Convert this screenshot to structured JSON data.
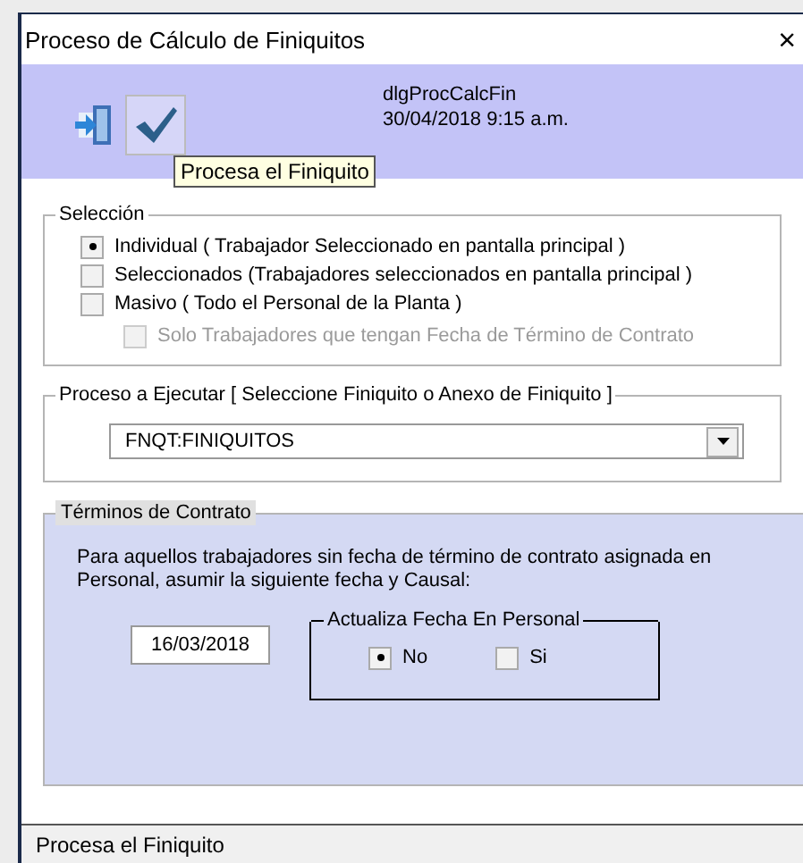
{
  "window": {
    "title": "Proceso de Cálculo de Finiquitos",
    "close": "×"
  },
  "toolbar": {
    "form_name": "dlgProcCalcFin",
    "datetime": "30/04/2018 9:15 a.m.",
    "tooltip": "Procesa el Finiquito"
  },
  "seleccion": {
    "title": "Selección",
    "options": [
      {
        "label": "Individual ( Trabajador Seleccionado en pantalla principal )",
        "selected": true
      },
      {
        "label": "Seleccionados (Trabajadores seleccionados en pantalla principal )",
        "selected": false
      },
      {
        "label": "Masivo ( Todo el Personal de la Planta )",
        "selected": false
      }
    ],
    "filter": {
      "label": "Solo Trabajadores que tengan Fecha de Término de Contrato",
      "checked": false,
      "disabled": true
    }
  },
  "proceso": {
    "title": "Proceso a Ejecutar [ Seleccione Finiquito o Anexo de Finiquito ]",
    "value": "FNQT:FINIQUITOS"
  },
  "terminos": {
    "title": "Términos de Contrato",
    "description": "Para aquellos trabajadores sin fecha de término de contrato asignada en Personal, asumir la siguiente fecha y Causal:",
    "date": "16/03/2018",
    "update": {
      "title": "Actualiza Fecha En Personal",
      "options": [
        {
          "label": "No",
          "selected": true
        },
        {
          "label": "Si",
          "selected": false
        }
      ]
    }
  },
  "status_bar": "Procesa el Finiquito"
}
